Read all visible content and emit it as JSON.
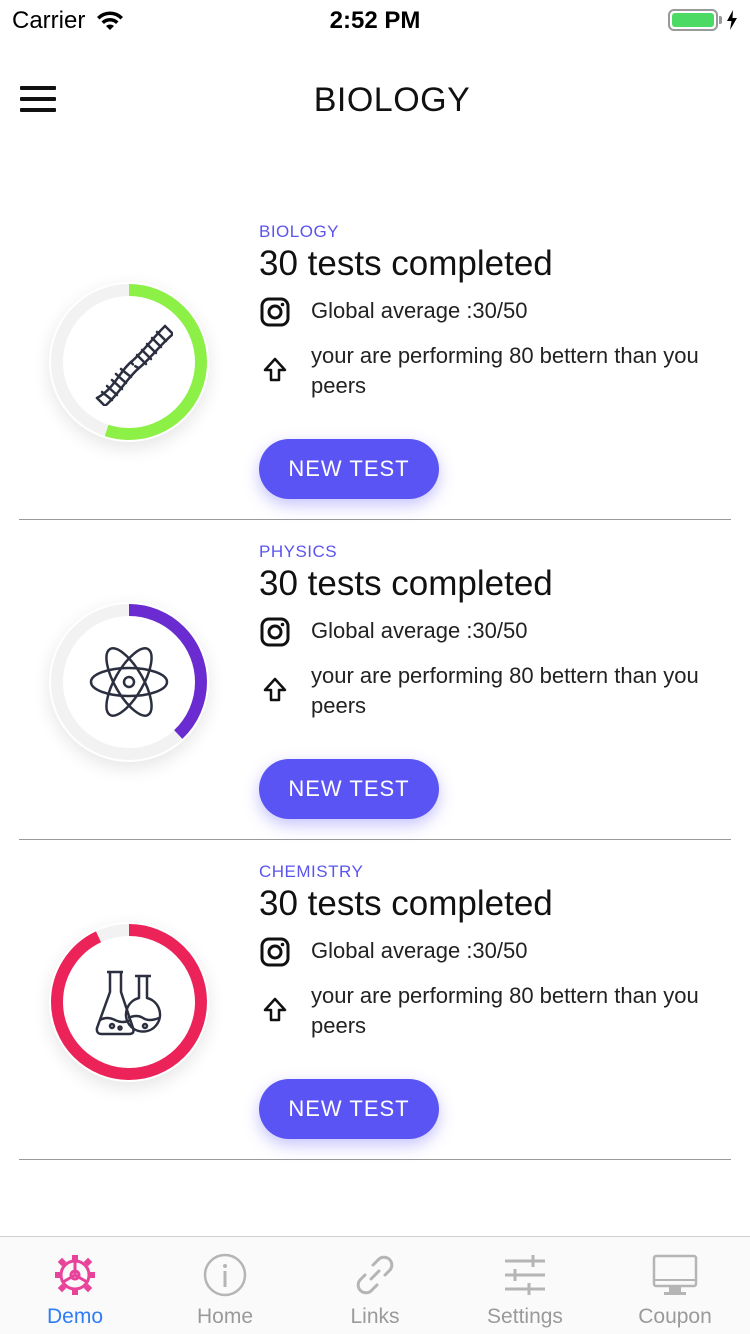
{
  "status_bar": {
    "carrier": "Carrier",
    "time": "2:52 PM",
    "battery_level": 1.0
  },
  "header": {
    "title": "BIOLOGY",
    "menu_icon": "hamburger-menu-icon"
  },
  "cards": [
    {
      "subject": "BIOLOGY",
      "tests": "30 tests completed",
      "average": "Global average :30/50",
      "performance": "your are performing 80 bettern than you peers",
      "button": "NEW TEST",
      "ring_color": "#8cf046",
      "ring_progress": 0.55,
      "icon": "dna-icon"
    },
    {
      "subject": "PHYSICS",
      "tests": "30 tests completed",
      "average": "Global average :30/50",
      "performance": "your are performing 80 bettern than you peers",
      "button": "NEW TEST",
      "ring_color": "#6a2bd0",
      "ring_progress": 0.38,
      "icon": "atom-icon"
    },
    {
      "subject": "CHEMISTRY",
      "tests": "30 tests completed",
      "average": "Global average :30/50",
      "performance": "your are performing 80 bettern than you peers",
      "button": "NEW TEST",
      "ring_color": "#ec2358",
      "ring_progress": 0.93,
      "icon": "flasks-icon"
    }
  ],
  "tabs": [
    {
      "label": "Demo",
      "icon": "gear-icon",
      "active": true
    },
    {
      "label": "Home",
      "icon": "info-icon",
      "active": false
    },
    {
      "label": "Links",
      "icon": "link-icon",
      "active": false
    },
    {
      "label": "Settings",
      "icon": "sliders-icon",
      "active": false
    },
    {
      "label": "Coupon",
      "icon": "monitor-icon",
      "active": false
    }
  ],
  "colors": {
    "accent": "#5b54f5",
    "active_tab": "#2f7df6",
    "active_tab_icon": "#e8439a",
    "inactive": "#9a9a9a"
  }
}
